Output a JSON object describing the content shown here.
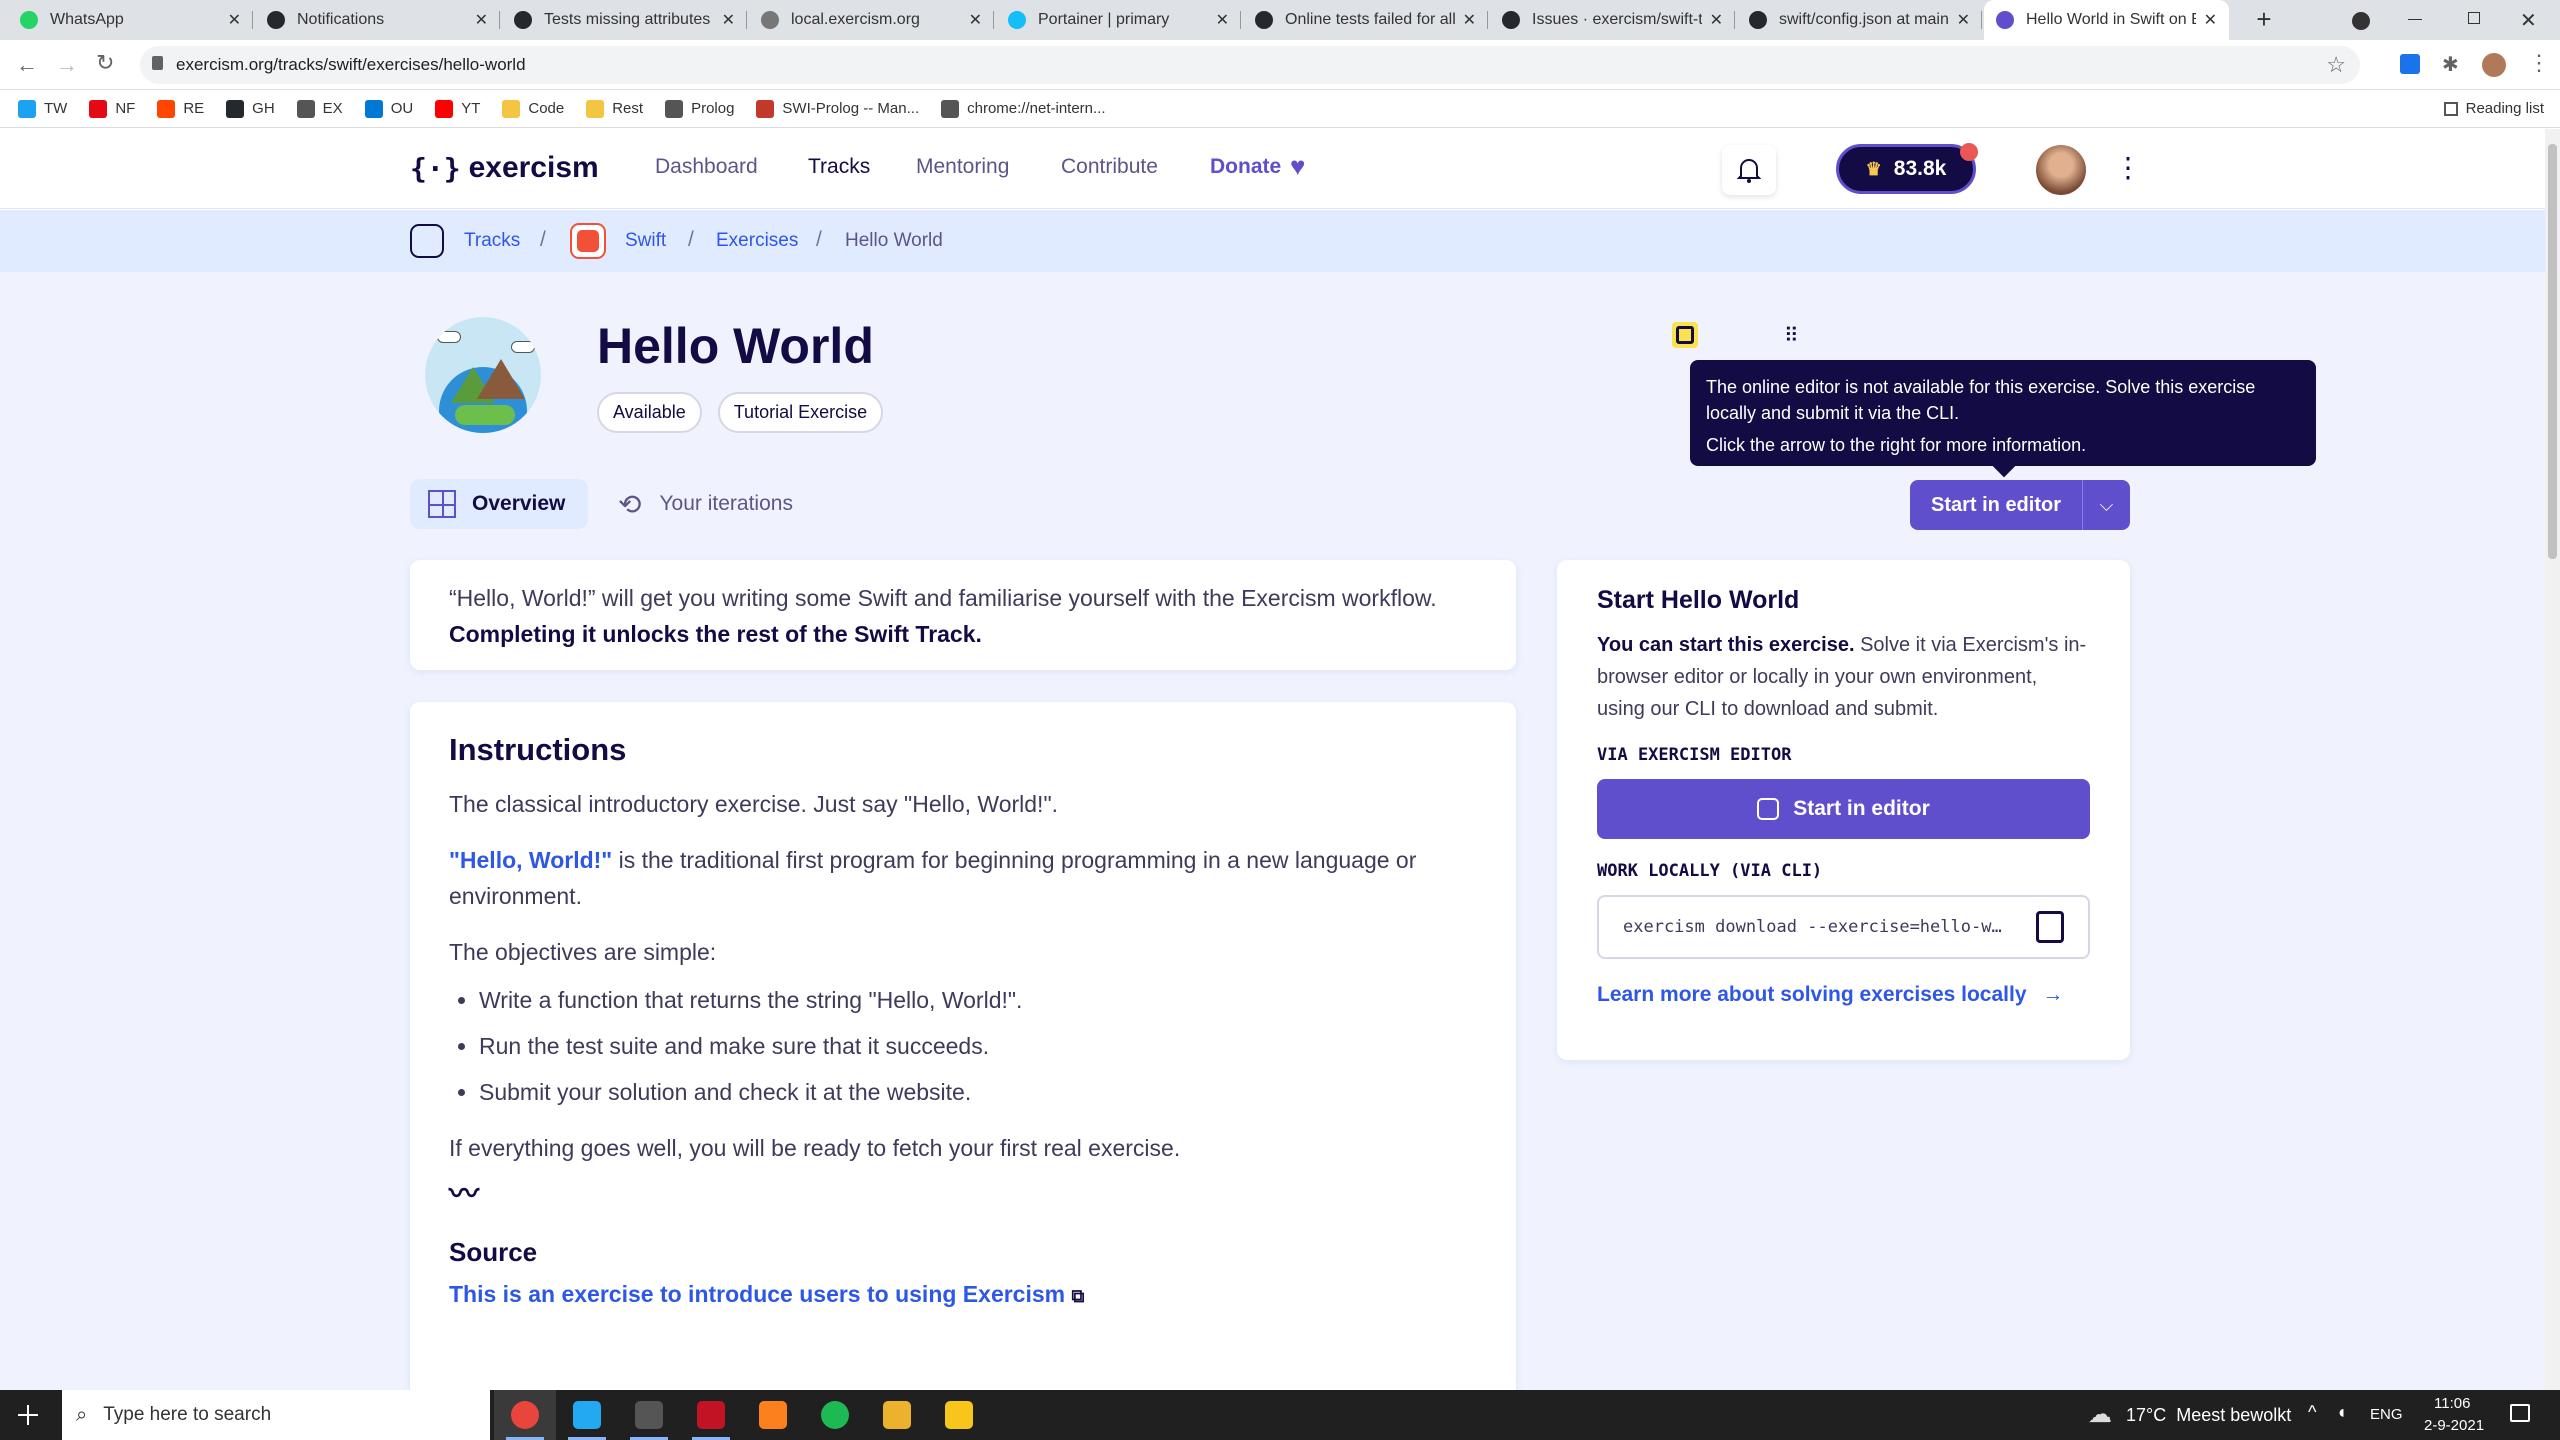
{
  "browser": {
    "tabs": [
      {
        "label": "WhatsApp",
        "color": "#25d366"
      },
      {
        "label": "Notifications",
        "color": "#24292e"
      },
      {
        "label": "Tests missing attributes",
        "color": "#24292e"
      },
      {
        "label": "local.exercism.org",
        "color": "#777777"
      },
      {
        "label": "Portainer | primary",
        "color": "#13bef9"
      },
      {
        "label": "Online tests failed for all",
        "color": "#24292e"
      },
      {
        "label": "Issues · exercism/swift-te",
        "color": "#24292e"
      },
      {
        "label": "swift/config.json at main",
        "color": "#24292e"
      },
      {
        "label": "Hello World in Swift on E",
        "color": "#604fcd"
      }
    ],
    "url": "exercism.org/tracks/swift/exercises/hello-world",
    "bookmarks": [
      {
        "label": "TW",
        "color": "#1da1f2"
      },
      {
        "label": "NF",
        "color": "#e50914"
      },
      {
        "label": "RE",
        "color": "#ff4500"
      },
      {
        "label": "GH",
        "color": "#24292e"
      },
      {
        "label": "EX",
        "color": "#555555"
      },
      {
        "label": "OU",
        "color": "#0078d4"
      },
      {
        "label": "YT",
        "color": "#ff0000"
      },
      {
        "label": "Code",
        "color": "#f4c542"
      },
      {
        "label": "Rest",
        "color": "#f4c542"
      },
      {
        "label": "Prolog",
        "color": "#555555"
      },
      {
        "label": "SWI-Prolog -- Man...",
        "color": "#c0392b"
      },
      {
        "label": "chrome://net-intern...",
        "color": "#555555"
      }
    ],
    "reading_list": "Reading list"
  },
  "header": {
    "logo": "exercism",
    "nav": [
      "Dashboard",
      "Tracks",
      "Mentoring",
      "Contribute",
      "Donate"
    ],
    "reputation": "83.8k"
  },
  "breadcrumbs": [
    "Tracks",
    "Swift",
    "Exercises",
    "Hello World"
  ],
  "exercise": {
    "title": "Hello World",
    "badges": [
      "Available",
      "Tutorial Exercise"
    ],
    "tabs": [
      "Overview",
      "Your iterations"
    ],
    "start_button": "Start in editor"
  },
  "tooltip": {
    "line1": "The online editor is not available for this exercise. Solve this exercise locally and submit it via the CLI.",
    "line2": "Click the arrow to the right for more information."
  },
  "intro": {
    "text": "“Hello, World!” will get you writing some Swift and familiarise yourself with the Exercism workflow.",
    "bold": "Completing it unlocks the rest of the Swift Track."
  },
  "instructions": {
    "heading": "Instructions",
    "p1": "The classical introductory exercise. Just say \"Hello, World!\".",
    "p2_link": "\"Hello, World!\"",
    "p2_rest": " is the traditional first program for beginning programming in a new language or environment.",
    "p3": "The objectives are simple:",
    "bullets": [
      "Write a function that returns the string \"Hello, World!\".",
      "Run the test suite and make sure that it succeeds.",
      "Submit your solution and check it at the website."
    ],
    "p4": "If everything goes well, you will be ready to fetch your first real exercise.",
    "source_heading": "Source",
    "source_link": "This is an exercise to introduce users to using Exercism"
  },
  "sidebar": {
    "title": "Start Hello World",
    "desc_bold": "You can start this exercise.",
    "desc": " Solve it via Exercism's in-browser editor or locally in your own environment, using our CLI to download and submit.",
    "editor_label": "VIA EXERCISM EDITOR",
    "editor_button": "Start in editor",
    "cli_label": "WORK LOCALLY (VIA CLI)",
    "cli_command": "exercism download --exercise=hello-w…",
    "learn_more": "Learn more about solving exercises locally"
  },
  "taskbar": {
    "search_placeholder": "Type here to search",
    "weather": "17°C  Meest bewolkt",
    "lang": "ENG",
    "time": "11:06",
    "date": "2-9-2021"
  }
}
